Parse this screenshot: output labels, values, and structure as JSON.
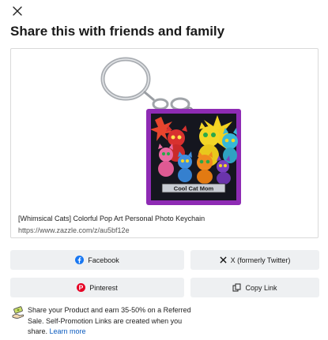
{
  "dialog": {
    "title": "Share this with friends and family",
    "close_icon": "close-icon"
  },
  "product": {
    "name": "[Whimsical Cats] Colorful Pop Art Personal Photo Keychain",
    "url": "https://www.zazzle.com/z/au5bf12e",
    "image_caption": "Cool Cat Mom",
    "colors": {
      "frame": "#8e2bb4",
      "caption_bg": "#c9cdd4"
    }
  },
  "share_buttons": {
    "facebook": {
      "label": "Facebook",
      "icon": "facebook-icon",
      "color": "#1877f2"
    },
    "twitter": {
      "label": "X (formerly Twitter)",
      "icon": "x-icon"
    },
    "pinterest": {
      "label": "Pinterest",
      "icon": "pinterest-icon",
      "color": "#e60023"
    },
    "copy_link": {
      "label": "Copy Link",
      "icon": "copy-link-icon"
    }
  },
  "promo": {
    "text": "Share your Product and earn 35-50% on a Referred Sale. Self-Promotion Links are created when you share.",
    "link_label": "Learn more",
    "icon": "money-hand-icon"
  }
}
